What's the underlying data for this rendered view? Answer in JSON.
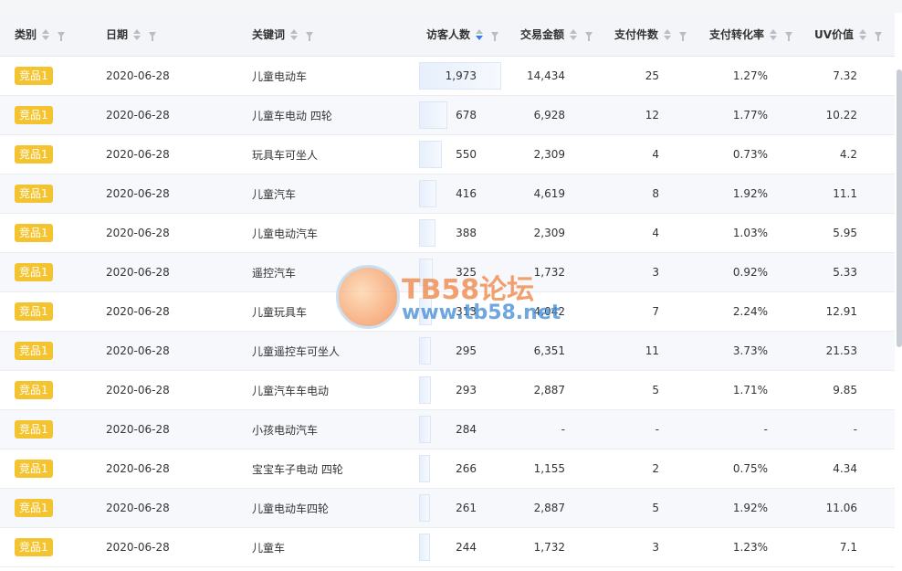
{
  "columns": {
    "category": "类别",
    "date": "日期",
    "keyword": "关键词",
    "visitors": "访客人数",
    "amount": "交易金额",
    "items": "支付件数",
    "conv": "支付转化率",
    "uv": "UV价值"
  },
  "sort_active": "visitors",
  "rows": [
    {
      "category": "竞品1",
      "date": "2020-06-28",
      "keyword": "儿童电动车",
      "visitors": "1,973",
      "visitors_num": 1973,
      "amount": "14,434",
      "items": "25",
      "conv": "1.27%",
      "uv": "7.32"
    },
    {
      "category": "竞品1",
      "date": "2020-06-28",
      "keyword": "儿童车电动 四轮",
      "visitors": "678",
      "visitors_num": 678,
      "amount": "6,928",
      "items": "12",
      "conv": "1.77%",
      "uv": "10.22"
    },
    {
      "category": "竞品1",
      "date": "2020-06-28",
      "keyword": "玩具车可坐人",
      "visitors": "550",
      "visitors_num": 550,
      "amount": "2,309",
      "items": "4",
      "conv": "0.73%",
      "uv": "4.2"
    },
    {
      "category": "竞品1",
      "date": "2020-06-28",
      "keyword": "儿童汽车",
      "visitors": "416",
      "visitors_num": 416,
      "amount": "4,619",
      "items": "8",
      "conv": "1.92%",
      "uv": "11.1"
    },
    {
      "category": "竞品1",
      "date": "2020-06-28",
      "keyword": "儿童电动汽车",
      "visitors": "388",
      "visitors_num": 388,
      "amount": "2,309",
      "items": "4",
      "conv": "1.03%",
      "uv": "5.95"
    },
    {
      "category": "竞品1",
      "date": "2020-06-28",
      "keyword": "遥控汽车",
      "visitors": "325",
      "visitors_num": 325,
      "amount": "1,732",
      "items": "3",
      "conv": "0.92%",
      "uv": "5.33"
    },
    {
      "category": "竞品1",
      "date": "2020-06-28",
      "keyword": "儿童玩具车",
      "visitors": "313",
      "visitors_num": 313,
      "amount": "4,042",
      "items": "7",
      "conv": "2.24%",
      "uv": "12.91"
    },
    {
      "category": "竞品1",
      "date": "2020-06-28",
      "keyword": "儿童遥控车可坐人",
      "visitors": "295",
      "visitors_num": 295,
      "amount": "6,351",
      "items": "11",
      "conv": "3.73%",
      "uv": "21.53"
    },
    {
      "category": "竞品1",
      "date": "2020-06-28",
      "keyword": "儿童汽车车电动",
      "visitors": "293",
      "visitors_num": 293,
      "amount": "2,887",
      "items": "5",
      "conv": "1.71%",
      "uv": "9.85"
    },
    {
      "category": "竞品1",
      "date": "2020-06-28",
      "keyword": "小孩电动汽车",
      "visitors": "284",
      "visitors_num": 284,
      "amount": "-",
      "items": "-",
      "conv": "-",
      "uv": "-"
    },
    {
      "category": "竞品1",
      "date": "2020-06-28",
      "keyword": "宝宝车子电动 四轮",
      "visitors": "266",
      "visitors_num": 266,
      "amount": "1,155",
      "items": "2",
      "conv": "0.75%",
      "uv": "4.34"
    },
    {
      "category": "竞品1",
      "date": "2020-06-28",
      "keyword": "儿童电动车四轮",
      "visitors": "261",
      "visitors_num": 261,
      "amount": "2,887",
      "items": "5",
      "conv": "1.92%",
      "uv": "11.06"
    },
    {
      "category": "竞品1",
      "date": "2020-06-28",
      "keyword": "儿童车",
      "visitors": "244",
      "visitors_num": 244,
      "amount": "1,732",
      "items": "3",
      "conv": "1.23%",
      "uv": "7.1"
    }
  ],
  "watermark": {
    "title": "TB58论坛",
    "url": "www.tb58.net"
  },
  "colors": {
    "tag": "#f4c430",
    "sort_active": "#2f7df6",
    "bar": "#e6effb"
  }
}
